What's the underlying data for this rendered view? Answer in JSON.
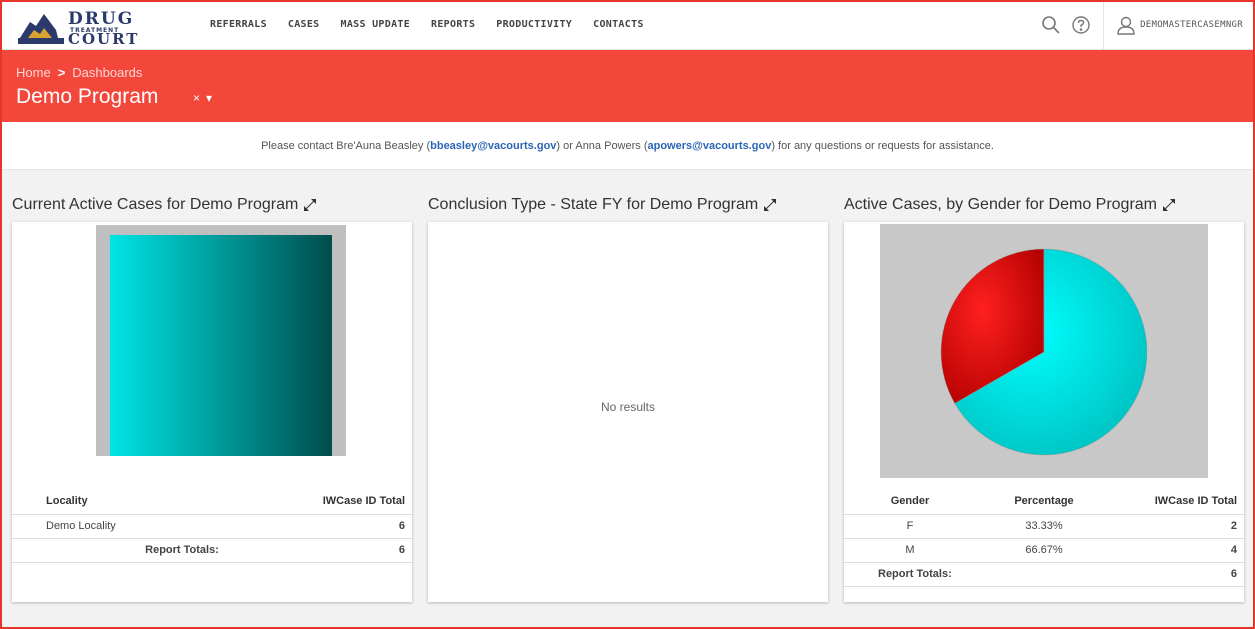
{
  "nav": {
    "logo": {
      "line1": "DRUG",
      "line2": "TREATMENT",
      "line3": "COURT"
    },
    "items": [
      "REFERRALS",
      "CASES",
      "MASS UPDATE",
      "REPORTS",
      "PRODUCTIVITY",
      "CONTACTS"
    ],
    "username": "DEMOMASTERCASEMNGR"
  },
  "header": {
    "breadcrumb": [
      "Home",
      "Dashboards"
    ],
    "breadcrumb_sep": ">",
    "title": "Demo Program",
    "clear_glyph": "×",
    "dropdown_glyph": "▾",
    "color": "#f4473b"
  },
  "contact": {
    "prefix": "Please contact Bre'Auna Beasley (",
    "email1": "bbeasley@vacourts.gov",
    "middle": ") or  Anna Powers (",
    "email2": "apowers@vacourts.gov",
    "suffix": ") for any questions or requests for assistance."
  },
  "panels": {
    "active_cases": {
      "title": "Current Active Cases for Demo Program",
      "table": {
        "headers": [
          "Locality",
          "IWCase ID Total"
        ],
        "rows": [
          [
            "Demo Locality",
            "6"
          ]
        ],
        "totals_label": "Report Totals:",
        "totals_value": "6"
      }
    },
    "conclusion": {
      "title": "Conclusion Type - State FY for Demo Program",
      "empty": "No results"
    },
    "gender": {
      "title": "Active Cases, by Gender for Demo Program",
      "table": {
        "headers": [
          "Gender",
          "Percentage",
          "IWCase ID Total"
        ],
        "rows": [
          [
            "F",
            "33.33%",
            "2"
          ],
          [
            "M",
            "66.67%",
            "4"
          ]
        ],
        "totals_label": "Report Totals:",
        "totals_value": "6"
      }
    }
  },
  "chart_data": [
    {
      "type": "bar",
      "categories": [
        "Demo Locality"
      ],
      "values": [
        6
      ],
      "ylim": [
        0,
        6
      ],
      "colors": [
        "#00e5e5",
        "#004d4d"
      ]
    },
    {
      "type": "pie",
      "categories": [
        "F",
        "M"
      ],
      "values": [
        33.33,
        66.67
      ],
      "colors": [
        "#b30000",
        "#00bfbf"
      ]
    }
  ]
}
